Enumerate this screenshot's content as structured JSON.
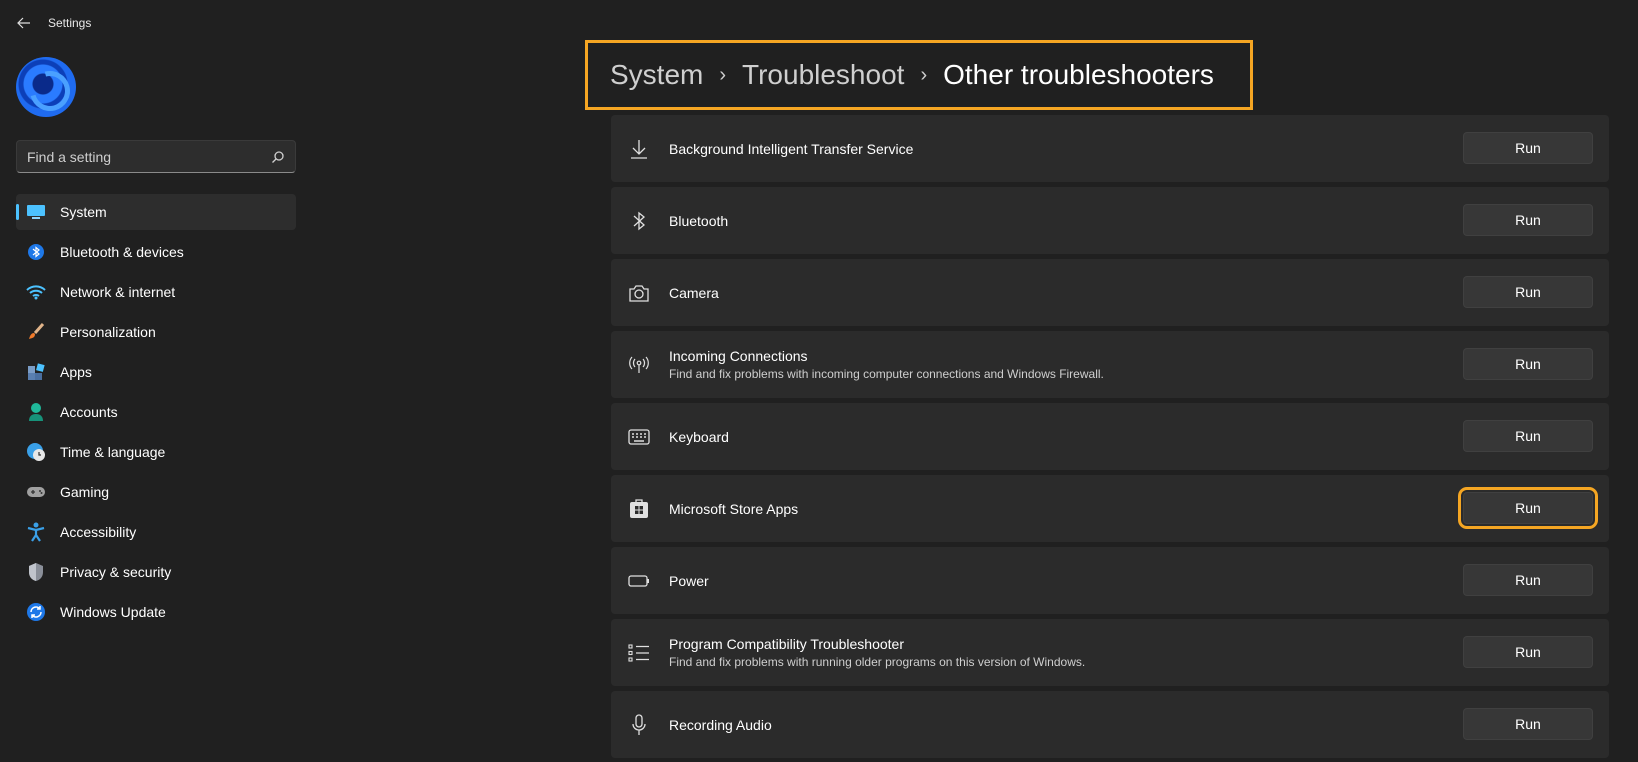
{
  "app": {
    "title": "Settings"
  },
  "search": {
    "placeholder": "Find a setting"
  },
  "nav": {
    "items": [
      {
        "label": "System",
        "icon": "monitor-icon",
        "active": true
      },
      {
        "label": "Bluetooth & devices",
        "icon": "bluetooth-icon"
      },
      {
        "label": "Network & internet",
        "icon": "wifi-icon"
      },
      {
        "label": "Personalization",
        "icon": "brush-icon"
      },
      {
        "label": "Apps",
        "icon": "apps-icon"
      },
      {
        "label": "Accounts",
        "icon": "person-icon"
      },
      {
        "label": "Time & language",
        "icon": "clock-globe-icon"
      },
      {
        "label": "Gaming",
        "icon": "gamepad-icon"
      },
      {
        "label": "Accessibility",
        "icon": "accessibility-icon"
      },
      {
        "label": "Privacy & security",
        "icon": "shield-icon"
      },
      {
        "label": "Windows Update",
        "icon": "update-icon"
      }
    ]
  },
  "breadcrumb": {
    "items": [
      "System",
      "Troubleshoot",
      "Other troubleshooters"
    ],
    "separator": "›"
  },
  "troubleshooters": [
    {
      "title": "Background Intelligent Transfer Service",
      "desc": "",
      "icon": "download-icon",
      "button": "Run"
    },
    {
      "title": "Bluetooth",
      "desc": "",
      "icon": "bluetooth-icon",
      "button": "Run"
    },
    {
      "title": "Camera",
      "desc": "",
      "icon": "camera-icon",
      "button": "Run"
    },
    {
      "title": "Incoming Connections",
      "desc": "Find and fix problems with incoming computer connections and Windows Firewall.",
      "icon": "antenna-icon",
      "button": "Run"
    },
    {
      "title": "Keyboard",
      "desc": "",
      "icon": "keyboard-icon",
      "button": "Run"
    },
    {
      "title": "Microsoft Store Apps",
      "desc": "",
      "icon": "store-icon",
      "button": "Run",
      "highlighted": true
    },
    {
      "title": "Power",
      "desc": "",
      "icon": "battery-icon",
      "button": "Run"
    },
    {
      "title": "Program Compatibility Troubleshooter",
      "desc": "Find and fix problems with running older programs on this version of Windows.",
      "icon": "list-icon",
      "button": "Run"
    },
    {
      "title": "Recording Audio",
      "desc": "",
      "icon": "microphone-icon",
      "button": "Run"
    }
  ],
  "colors": {
    "accent": "#4cc2ff",
    "highlight": "#f5a623",
    "background": "#202020",
    "card": "#2b2b2b"
  }
}
